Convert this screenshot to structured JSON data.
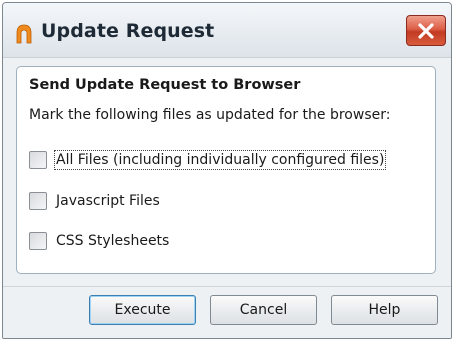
{
  "window": {
    "title": "Update Request",
    "icon": "app-logo-icon",
    "close_icon": "close-icon"
  },
  "group": {
    "header": "Send Update Request to Browser",
    "instruction": "Mark the following files as updated for the browser:"
  },
  "options": [
    {
      "label": "All Files (including individually configured files)",
      "checked": false
    },
    {
      "label": "Javascript Files",
      "checked": false
    },
    {
      "label": "CSS Stylesheets",
      "checked": false
    }
  ],
  "buttons": {
    "execute": "Execute",
    "cancel": "Cancel",
    "help": "Help"
  },
  "colors": {
    "close_button": "#d04a30",
    "app_icon": "#f08a1c",
    "default_button_border": "#3c7fb1"
  }
}
